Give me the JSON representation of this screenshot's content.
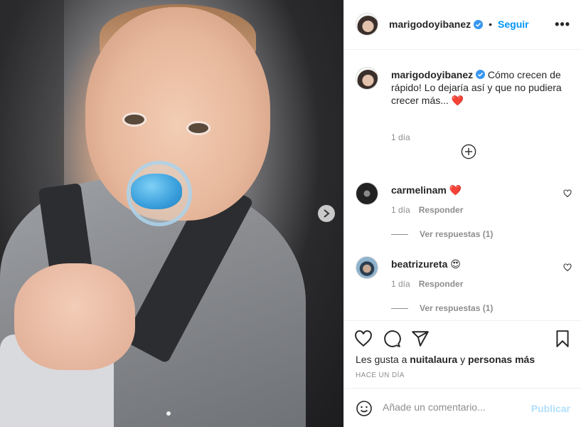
{
  "post": {
    "author": "marigodoyibanez",
    "follow_label": "Seguir",
    "separator": "•",
    "more_label": "•••",
    "caption_text": "Cómo crecen de rápido! Lo dejaría así y que no pudiera crecer más... ❤️",
    "caption_time": "1 día"
  },
  "comments": [
    {
      "user": "carmelinam",
      "text": "❤️",
      "time": "1 día",
      "reply_label": "Responder",
      "view_replies": "Ver respuestas (1)"
    },
    {
      "user": "beatrizureta",
      "text": "😍",
      "time": "1 día",
      "reply_label": "Responder",
      "view_replies": "Ver respuestas (1)"
    }
  ],
  "likes": {
    "prefix": "Les gusta a",
    "user": "nuitalaura",
    "connector": "y",
    "others": "personas más"
  },
  "posted_ago": "HACE UN DÍA",
  "add_comment": {
    "placeholder": "Añade un comentario...",
    "publish_label": "Publicar"
  },
  "colors": {
    "accent": "#0095f6",
    "verified": "#3897f0",
    "heart": "#ed4956",
    "muted": "#8e8e8e"
  }
}
